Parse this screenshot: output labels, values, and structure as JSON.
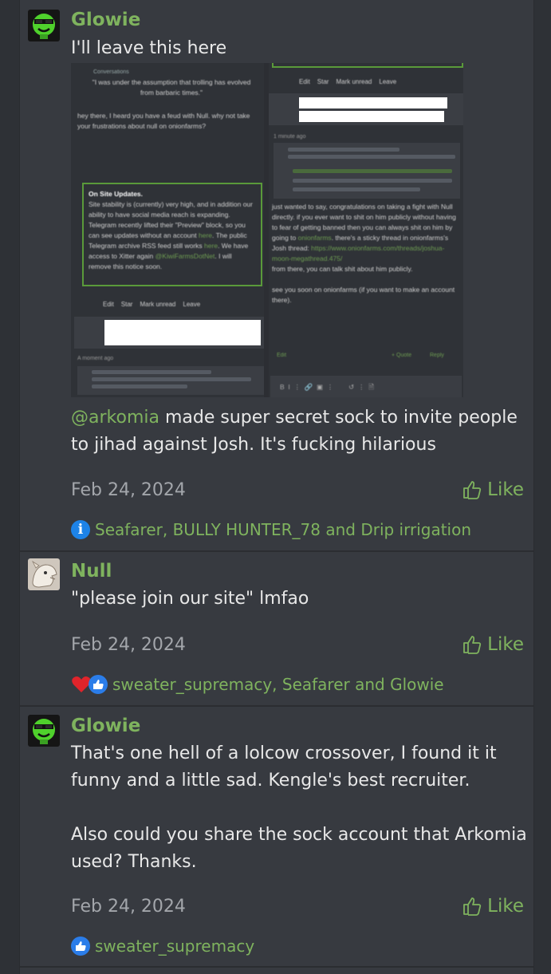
{
  "posts": [
    {
      "username": "Glowie",
      "text": "I'll leave this here",
      "mention": "@arkomia",
      "caption": " made super secret sock to invite people to jihad against Josh. It's fucking hilarious",
      "date": "Feb 24, 2024",
      "like_label": "Like",
      "reactions": "Seafarer, BULLY HUNTER_78 and Drip irrigation",
      "reaction_icons": [
        "info-icon"
      ]
    },
    {
      "username": "Null",
      "text": "\"please join our site\" lmfao",
      "date": "Feb 24, 2024",
      "like_label": "Like",
      "reactions": "sweater_supremacy, Seafarer and Glowie",
      "reaction_icons": [
        "heart-icon",
        "thumbs-up-icon"
      ]
    },
    {
      "username": "Glowie",
      "text_p1": "That's one hell of a lolcow crossover, I found it it funny and a little sad. Kengle's best recruiter.",
      "text_p2": "Also could you share the sock account that Arkomia used? Thanks.",
      "date": "Feb 24, 2024",
      "like_label": "Like",
      "reactions": "sweater_supremacy",
      "reaction_icons": [
        "thumbs-up-icon"
      ]
    }
  ],
  "embedded_screenshot": {
    "left": {
      "header": "Conversations",
      "quote": "\"I was under the assumption that trolling has evolved from barbaric times.\"",
      "message": "hey there, I heard you have a feud with Null. why not take your frustrations about null on onionfarms?",
      "notice_title": "On Site Updates.",
      "notice_body_a": "Site stability is (currently) very high, and in addition our ability to have social media reach is expanding. Telegram recently lifted their \"Preview\" block, so you can see updates without an account",
      "notice_link1": "here",
      "notice_body_b": ". The public Telegram archive RSS feed still works",
      "notice_link2": "here",
      "notice_body_c": ". We have access to Xitter again",
      "notice_link3": "@KiwiFarmsDotNet",
      "notice_body_d": ". I will remove this notice soon.",
      "buttons": [
        "Edit",
        "Star",
        "Mark unread",
        "Leave"
      ],
      "timestamp": "A moment ago"
    },
    "right": {
      "buttons": [
        "Edit",
        "Star",
        "Mark unread",
        "Leave"
      ],
      "timestamp": "1 minute ago",
      "message_a": "just wanted to say, congratulations on taking a fight with Null directly. if you ever want to shit on him publicly without having to fear of getting banned then you can always shit on him by going to",
      "message_link": "onionfarms",
      "message_b": ". there's a sticky thread in onionfarms's Josh thread:",
      "thread_url": "https://www.onionfarms.com/threads/joshua-moon-megathread.475/",
      "message_c": "from there, you can talk shit about him publicly.",
      "message_d": "see you soon on onionfarms (if you want to make an account there).",
      "edit": "Edit",
      "quote": "+ Quote",
      "reply": "Reply",
      "toolbar": "B  I  ⋮  🔗  ▣  ⋮        ↺  ⋮  🗎"
    }
  },
  "colors": {
    "username": "#7fb35e",
    "date": "#a3a6ab",
    "background": "#373a40",
    "outer_background": "#2e3136"
  }
}
